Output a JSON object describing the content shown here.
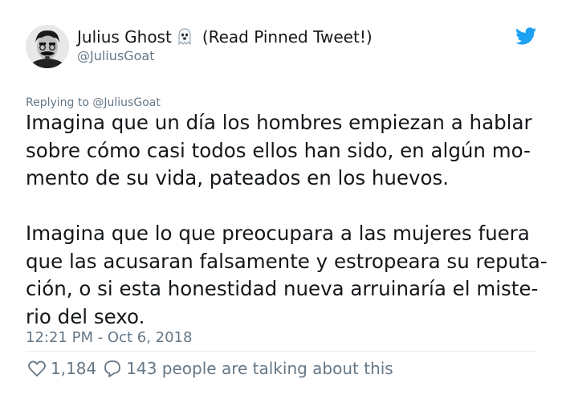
{
  "author": {
    "display_name": "Julius Ghost",
    "name_suffix": "(Read Pinned Tweet!)",
    "handle": "@JuliusGoat",
    "avatar_icon": "avatar-photo",
    "emoji_icon": "ghost-emoji"
  },
  "reply": {
    "prefix": "Replying to",
    "mention": "@JuliusGoat"
  },
  "body": {
    "paragraph1": [
      "Imagina que un día los hombres empiezan a hablar",
      "sobre cómo casi todos ellos han sido, en algún mo-",
      "mento de su vida, pateados en los huevos."
    ],
    "paragraph2": [
      "Imagina que lo que preocupara a las mujeres fuera",
      "que las acusaran falsamente y estropeara su reputa-",
      "ción, o si esta honestidad nueva arruinaría el miste-",
      "rio del sexo."
    ]
  },
  "timestamp": "12:21 PM - Oct 6, 2018",
  "stats": {
    "likes": "1,184",
    "replies_text": "143 people are talking about this"
  },
  "colors": {
    "twitter_blue": "#1da1f2",
    "muted_text": "#657786",
    "main_text": "#14171a"
  }
}
